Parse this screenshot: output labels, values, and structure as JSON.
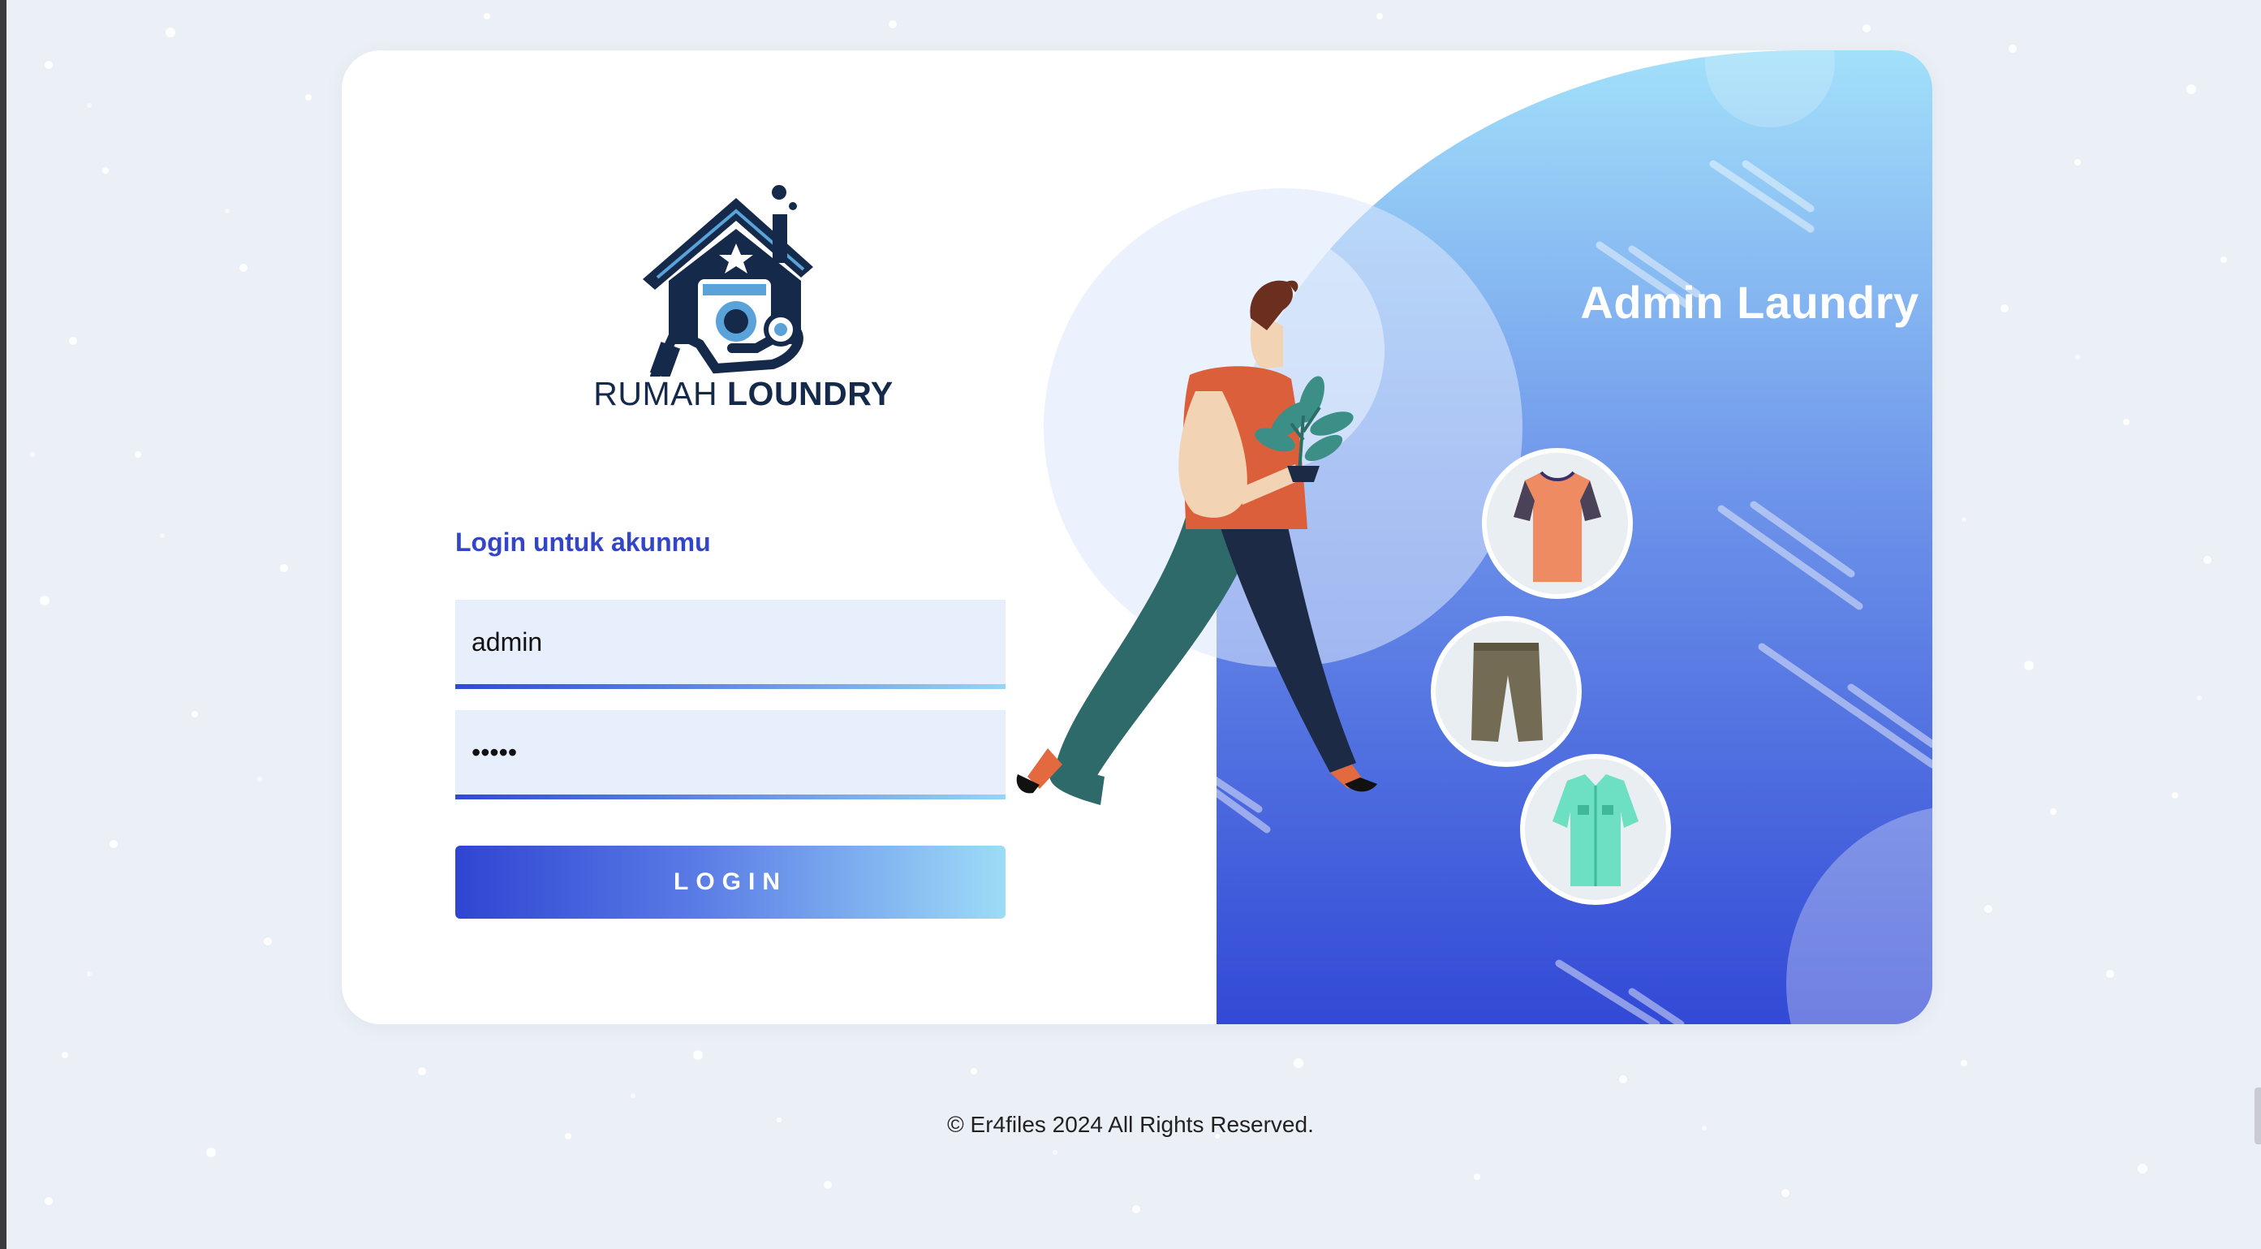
{
  "brand": {
    "name_light": "RUMAH",
    "name_bold": "LOUNDRY"
  },
  "login_form": {
    "heading": "Login untuk akunmu",
    "username_value": "admin",
    "password_value": "admin",
    "submit_label": "LOGIN"
  },
  "side_panel": {
    "title": "Admin Laundry"
  },
  "footer": {
    "copyright": "© Er4files 2024 All Rights Reserved."
  },
  "icons": [
    "laundry-house-logo-icon",
    "person-with-plant-illustration",
    "tshirt-icon",
    "trousers-icon",
    "shirt-icon"
  ],
  "colors": {
    "page_bg": "#ebf0f6",
    "accent": "#3346c7",
    "gradient_start": "#2f45d3",
    "gradient_end": "#9ddcf7",
    "logo_navy": "#15294a"
  }
}
